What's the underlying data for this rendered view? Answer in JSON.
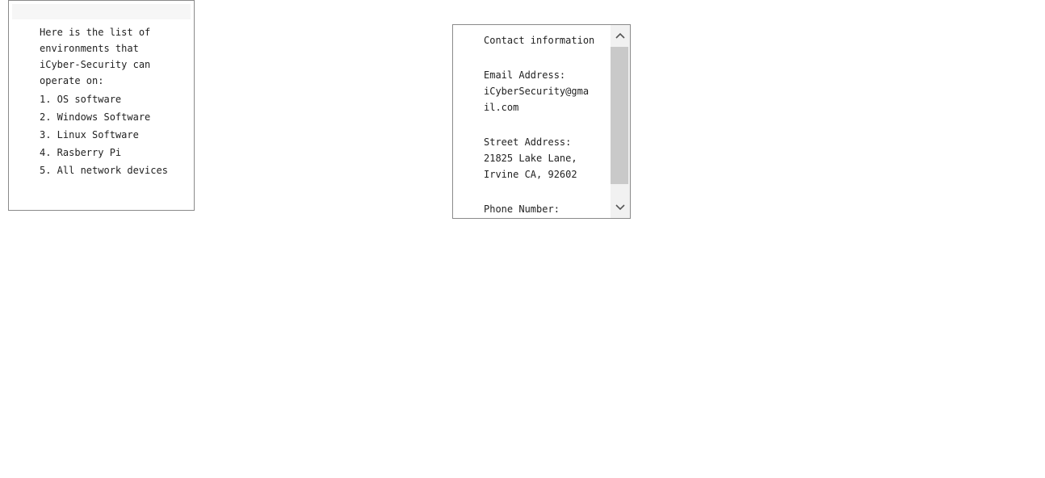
{
  "environments": {
    "intro": "Here is the list of environments that iCyber-Security can operate on:",
    "items": [
      "1. OS software",
      "2. Windows Software",
      "3. Linux Software",
      "4. Rasberry Pi",
      "5. All network devices"
    ]
  },
  "contact": {
    "title": "Contact information",
    "email_label": "Email Address:",
    "email_value": "iCyberSecurity@gmail.com",
    "street_label": "Street Address:",
    "street_line1": "21825 Lake Lane,",
    "street_line2": "Irvine CA, 92602",
    "phone_label": "Phone Number:",
    "scroll_up_icon": "chevron-up-icon",
    "scroll_down_icon": "chevron-down-icon"
  },
  "colors": {
    "border": "#8a8a8a",
    "scroll_track": "#f1f1f1",
    "scroll_thumb": "#c9c9c9",
    "text": "#222222"
  }
}
